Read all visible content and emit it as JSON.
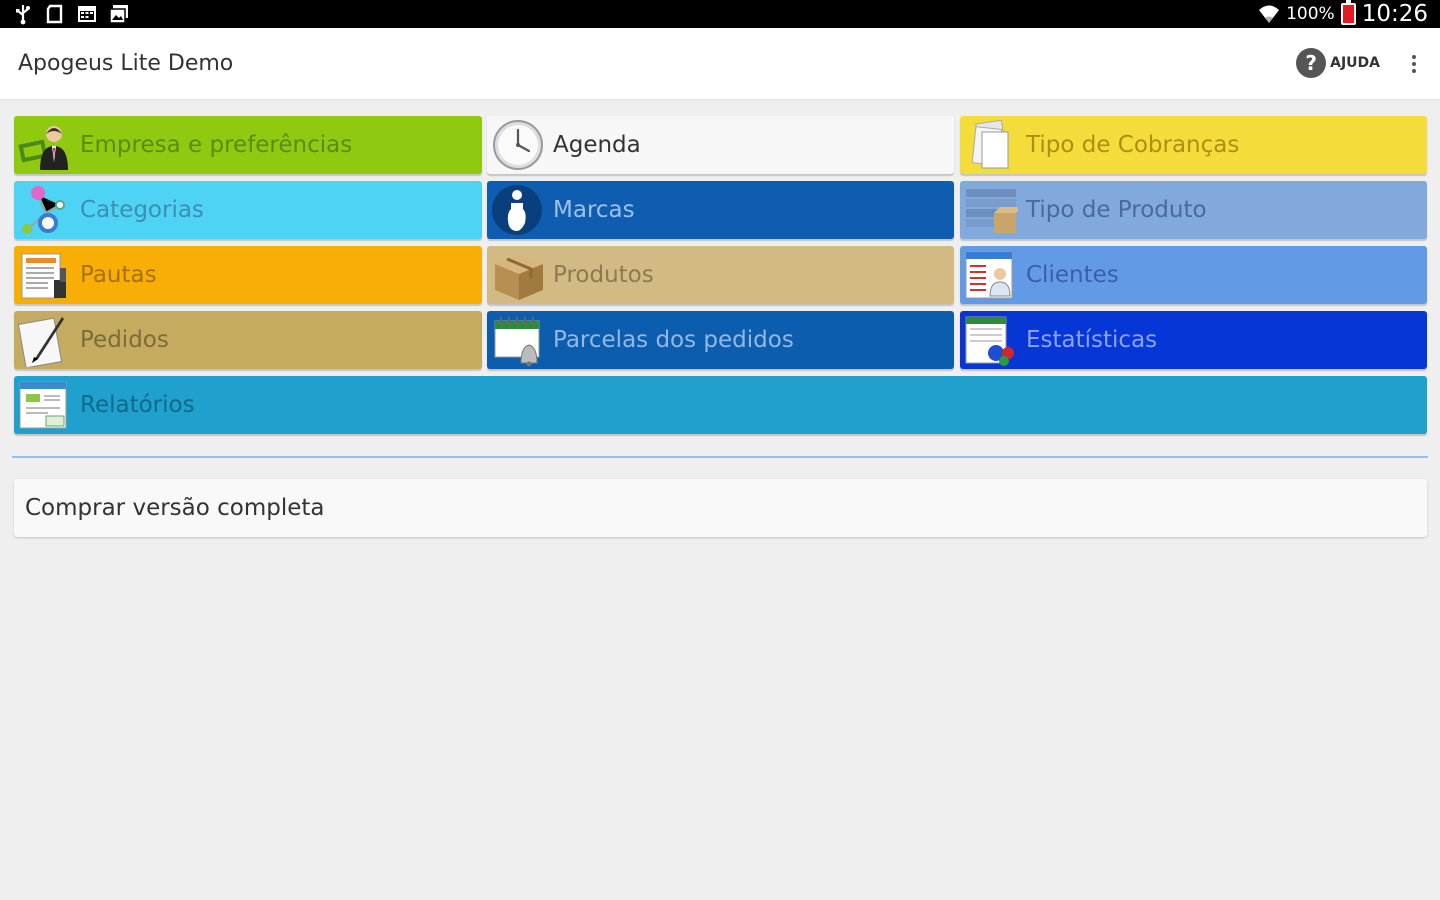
{
  "status_bar": {
    "left_icons": [
      "usb-icon",
      "sd-card-icon",
      "calendar-icon",
      "photo-icon"
    ],
    "battery": "100%",
    "time": "10:26"
  },
  "action_bar": {
    "title": "Apogeus Lite Demo",
    "help_label": "AJUDA",
    "help_glyph": "?"
  },
  "menu": {
    "tiles": [
      {
        "label": "Empresa e preferências",
        "icon": "businessman-icon",
        "bg": "#8fca10",
        "fg": "#5f8a10"
      },
      {
        "label": "Agenda",
        "icon": "clock-icon",
        "bg": "#f7f7f7",
        "fg": "#333333"
      },
      {
        "label": "Tipo de Cobranças",
        "icon": "documents-icon",
        "bg": "#f4dd3a",
        "fg": "#b08d10"
      },
      {
        "label": "Categorias",
        "icon": "molecule-icon",
        "bg": "#4fd3f5",
        "fg": "#3a8fb2"
      },
      {
        "label": "Marcas",
        "icon": "info-person-icon",
        "bg": "#0f5db0",
        "fg": "#9fc1e9"
      },
      {
        "label": "Tipo de Produto",
        "icon": "folder-box-icon",
        "bg": "#82a9dc",
        "fg": "#4a6a98"
      },
      {
        "label": "Pautas",
        "icon": "pricelist-icon",
        "bg": "#f8ae04",
        "fg": "#a8700a"
      },
      {
        "label": "Produtos",
        "icon": "box-icon",
        "bg": "#d2ba85",
        "fg": "#8d7a4d"
      },
      {
        "label": "Clientes",
        "icon": "client-card-icon",
        "bg": "#629ae6",
        "fg": "#3a5fa8"
      },
      {
        "label": "Pedidos",
        "icon": "pen-paper-icon",
        "bg": "#c4ab60",
        "fg": "#7d6c38"
      },
      {
        "label": "Parcelas dos pedidos",
        "icon": "calendar-bell-icon",
        "bg": "#0c5dad",
        "fg": "#93b8e6"
      },
      {
        "label": "Estatísticas",
        "icon": "stats-icon",
        "bg": "#0637d6",
        "fg": "#8da3ee"
      },
      {
        "label": "Relatórios",
        "icon": "reports-icon",
        "bg": "#20a1cd",
        "fg": "#0e6a8c"
      }
    ]
  },
  "buy": {
    "label": "Comprar versão completa"
  }
}
